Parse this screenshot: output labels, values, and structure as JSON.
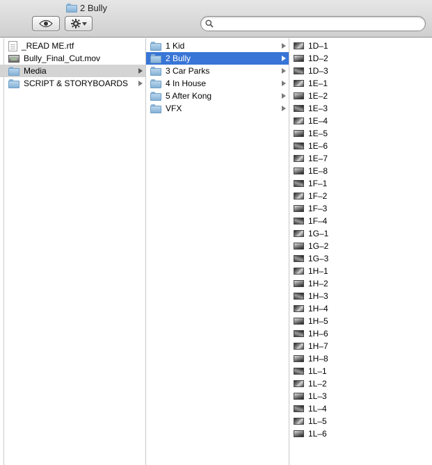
{
  "window": {
    "title": "2 Bully"
  },
  "search": {
    "placeholder": "",
    "value": ""
  },
  "columns": {
    "col1": [
      {
        "label": "_READ ME.rtf",
        "icon": "document-icon",
        "has_children": false
      },
      {
        "label": "Bully_Final_Cut.mov",
        "icon": "movie-icon",
        "has_children": false
      },
      {
        "label": "Media",
        "icon": "folder-icon",
        "has_children": true,
        "selected": "inactive"
      },
      {
        "label": "SCRIPT & STORYBOARDS",
        "icon": "folder-icon",
        "has_children": true
      }
    ],
    "col2": [
      {
        "label": "1 Kid",
        "icon": "folder-icon",
        "has_children": true
      },
      {
        "label": "2 Bully",
        "icon": "folder-icon",
        "has_children": true,
        "selected": "active"
      },
      {
        "label": "3 Car Parks",
        "icon": "folder-icon",
        "has_children": true
      },
      {
        "label": "4 In House",
        "icon": "folder-icon",
        "has_children": true
      },
      {
        "label": "5 After Kong",
        "icon": "folder-icon",
        "has_children": true
      },
      {
        "label": "VFX",
        "icon": "folder-icon",
        "has_children": true
      }
    ],
    "col3": [
      "1D–1",
      "1D–2",
      "1D–3",
      "1E–1",
      "1E–2",
      "1E–3",
      "1E–4",
      "1E–5",
      "1E–6",
      "1E–7",
      "1E–8",
      "1F–1",
      "1F–2",
      "1F–3",
      "1F–4",
      "1G–1",
      "1G–2",
      "1G–3",
      "1H–1",
      "1H–2",
      "1H–3",
      "1H–4",
      "1H–5",
      "1H–6",
      "1H–7",
      "1H–8",
      "1L–1",
      "1L–2",
      "1L–3",
      "1L–4",
      "1L–5",
      "1L–6"
    ]
  },
  "colors": {
    "selection_active": "#3875d7",
    "selection_inactive": "#d4d4d4"
  }
}
